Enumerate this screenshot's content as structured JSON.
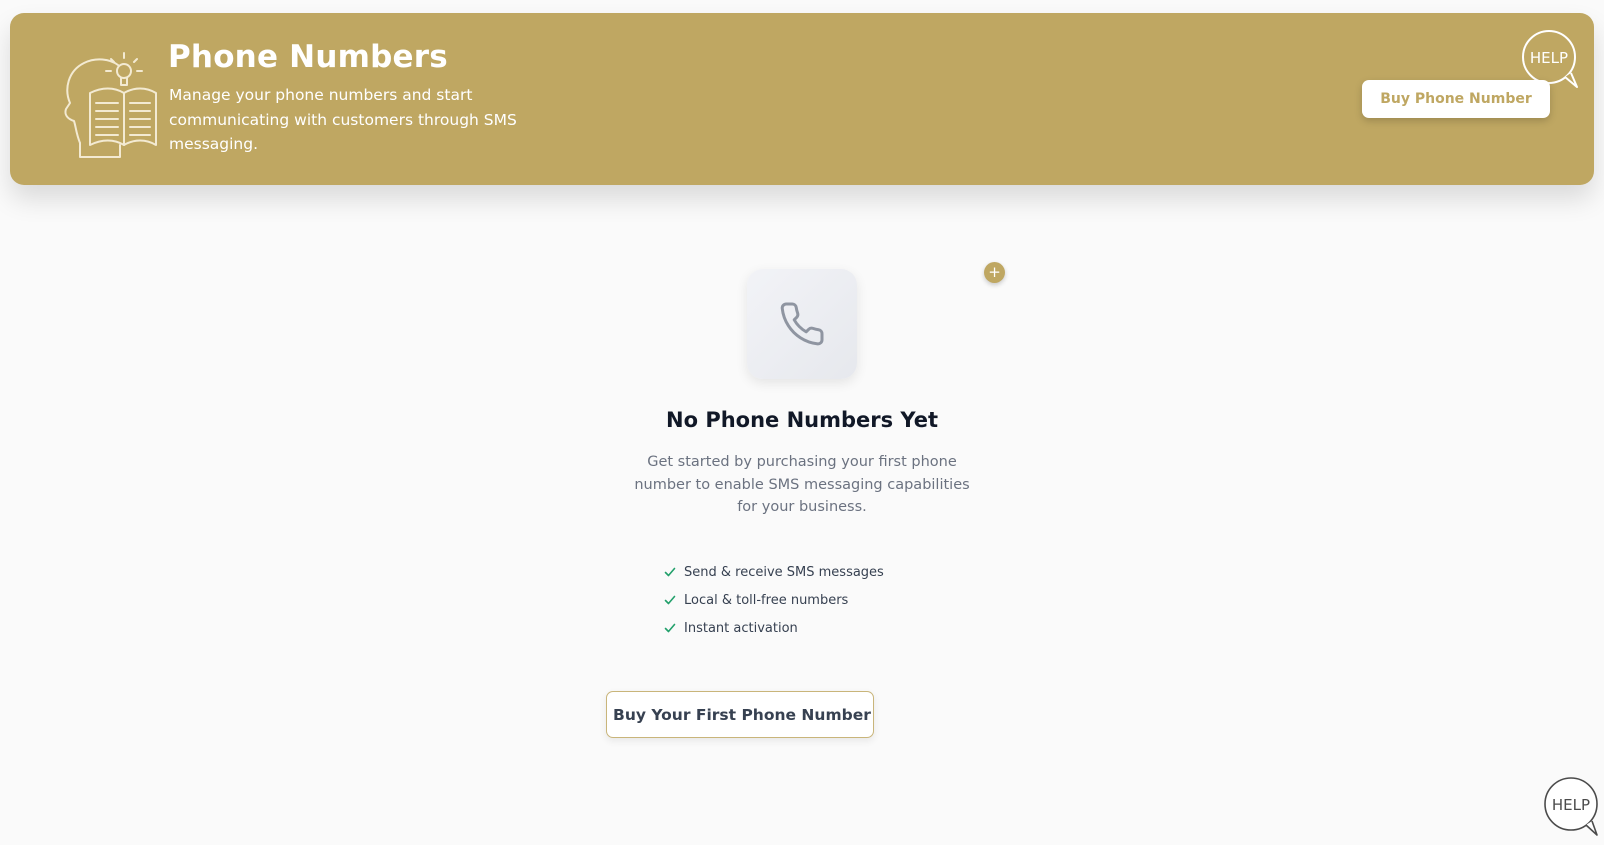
{
  "header": {
    "title": "Phone Numbers",
    "subtitle": "Manage your phone numbers and start communicating with customers through SMS messaging.",
    "buy_button_label": "Buy Phone Number",
    "help_label": "HELP",
    "illustration_icon": "head-with-book-icon",
    "background_color": "#bfa762"
  },
  "empty_state": {
    "icon": "phone-icon",
    "badge_icon": "plus-icon",
    "badge_symbol": "+",
    "title": "No Phone Numbers Yet",
    "description": "Get started by purchasing your first phone number to enable SMS messaging capabilities for your business.",
    "features": [
      "Send & receive SMS messages",
      "Local & toll-free numbers",
      "Instant activation"
    ],
    "cta_label": "Buy Your First Phone Number"
  },
  "help_widget": {
    "label": "HELP",
    "icon": "speech-bubble-icon"
  },
  "colors": {
    "accent": "#bfa762",
    "check": "#22a06b",
    "heading": "#111827",
    "body_text": "#6b7280"
  }
}
